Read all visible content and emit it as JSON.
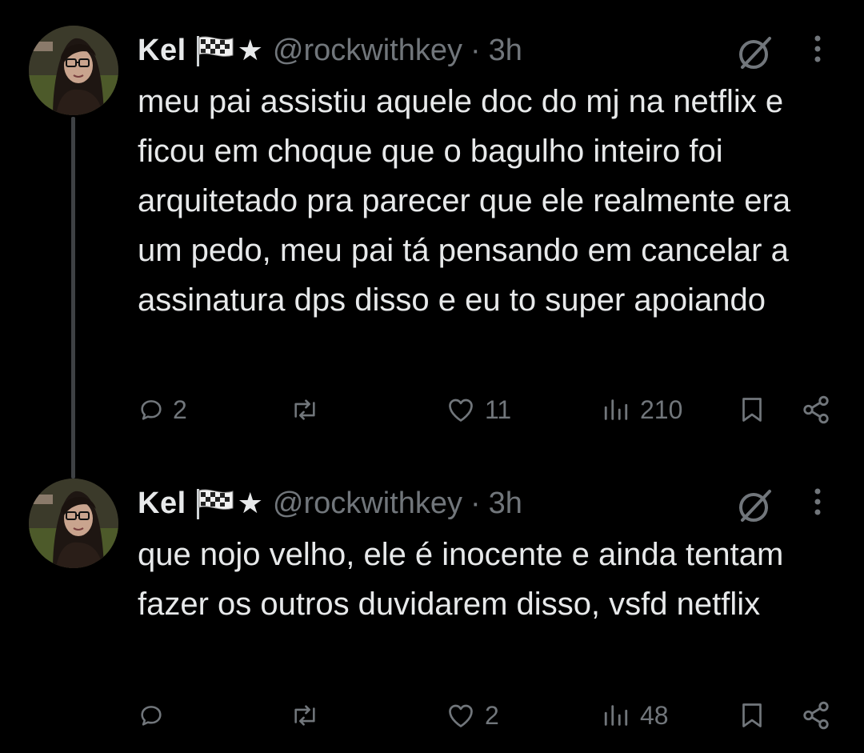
{
  "tweets": [
    {
      "display_name": "Kel",
      "handle": "@rockwithkey",
      "separator": "·",
      "time": "3h",
      "star": "★",
      "text": "meu pai assistiu aquele doc do mj na netflix e ficou em choque que o bagulho inteiro foi arquitetado pra parecer que ele realmente era um pedo, meu pai tá pensando em cancelar a assinatura dps disso e eu to super apoiando",
      "replies": "2",
      "reposts": "",
      "likes": "11",
      "views": "210",
      "has_thread_line": true
    },
    {
      "display_name": "Kel",
      "handle": "@rockwithkey",
      "separator": "·",
      "time": "3h",
      "star": "★",
      "text": "que nojo velho, ele é inocente e ainda tentam fazer os outros duvidarem disso, vsfd netflix",
      "replies": "",
      "reposts": "",
      "likes": "2",
      "views": "48",
      "has_thread_line": false
    }
  ],
  "icons": {
    "flag": "checkered-flag-icon",
    "grok": "grok-icon",
    "more": "more-vertical-icon",
    "reply": "reply-icon",
    "repost": "repost-icon",
    "like": "like-icon",
    "views": "views-icon",
    "bookmark": "bookmark-icon",
    "share": "share-icon"
  },
  "colors": {
    "background": "#000000",
    "text": "#e7e9ea",
    "secondary": "#71767b",
    "thread_line": "#3e4144"
  }
}
